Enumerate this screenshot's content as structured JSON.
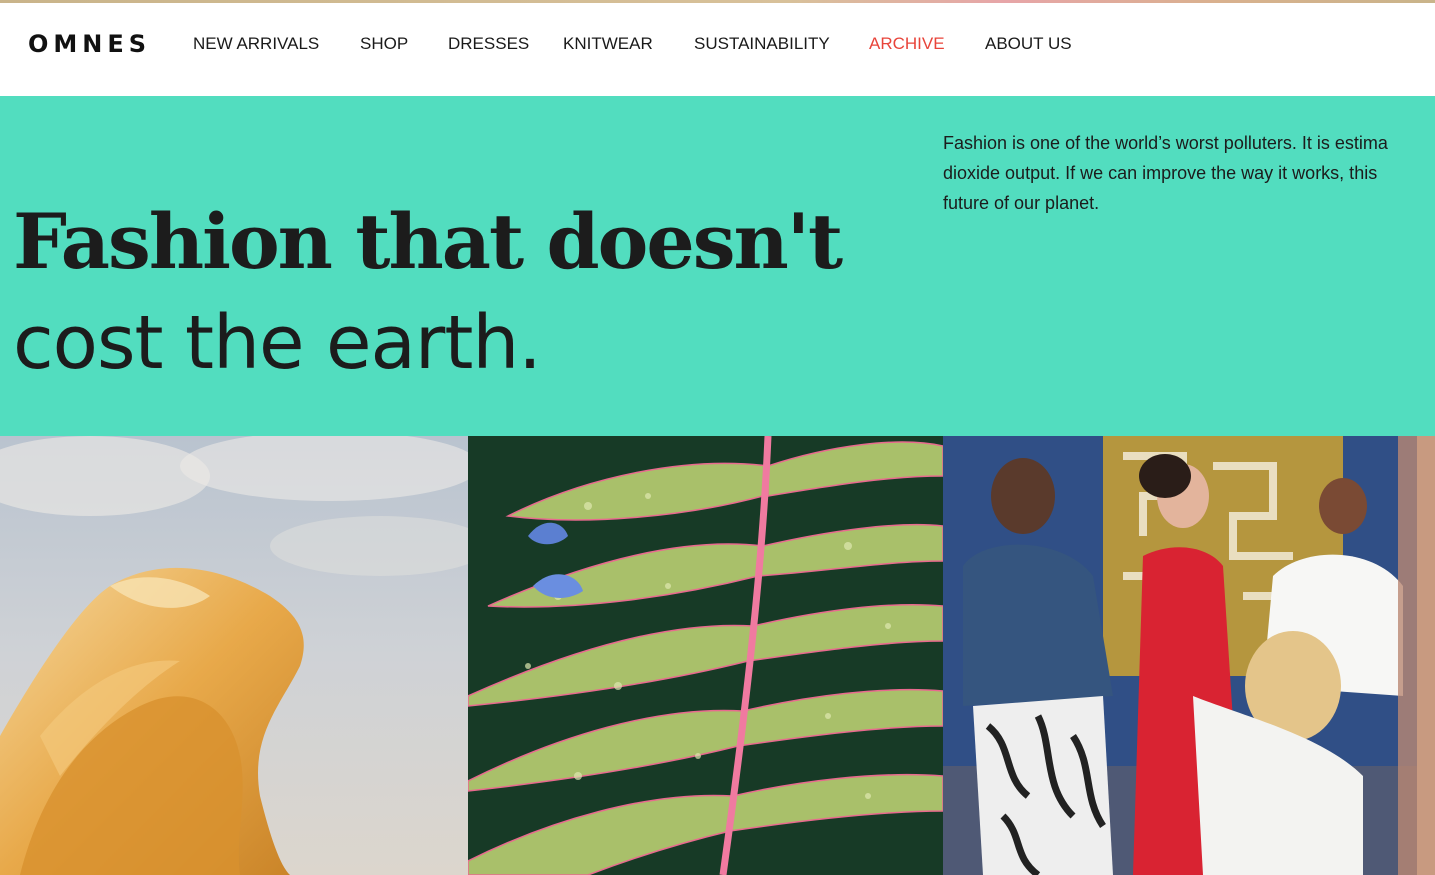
{
  "brand": {
    "logo_text": "OMNES"
  },
  "nav": {
    "items": [
      {
        "label": "NEW ARRIVALS",
        "active": false
      },
      {
        "label": "SHOP",
        "active": false
      },
      {
        "label": "DRESSES",
        "active": false
      },
      {
        "label": "KNITWEAR",
        "active": false
      },
      {
        "label": "SUSTAINABILITY",
        "active": false
      },
      {
        "label": "ARCHIVE",
        "active": true
      },
      {
        "label": "ABOUT US",
        "active": false
      }
    ]
  },
  "hero": {
    "headline_line1": "Fashion that doesn't",
    "headline_line2": "cost the earth.",
    "body_lines": [
      "Fashion is one of the world’s worst polluters. It is estima",
      "dioxide output. If we can improve the way it works, this",
      "future of our planet."
    ]
  },
  "images": [
    {
      "name": "flowing-fabric-image"
    },
    {
      "name": "fern-leaf-image"
    },
    {
      "name": "dress-fitting-image"
    }
  ],
  "colors": {
    "hero_background": "#52ddbf",
    "nav_active": "#e8443a",
    "text": "#1c1c1c"
  }
}
